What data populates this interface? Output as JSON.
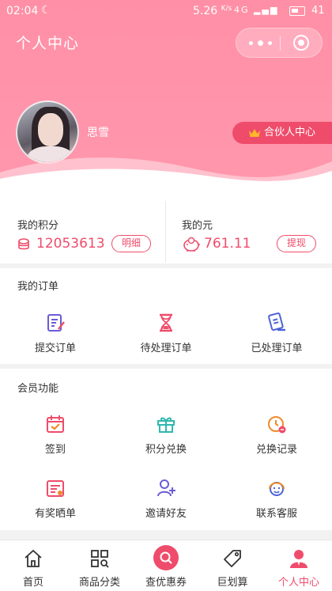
{
  "status_bar": {
    "time": "02:04",
    "speed": "5.26",
    "speed_unit": "K/s",
    "signal": "4G",
    "battery": "41"
  },
  "header": {
    "title": "个人中心",
    "user_name": "思雪",
    "partner_button": "合伙人中心"
  },
  "points": {
    "my_points_label": "我的积分",
    "my_points_value": "12053613",
    "detail_button": "明细",
    "my_yuan_label": "我的元",
    "my_yuan_value": "761.11",
    "withdraw_button": "提现"
  },
  "orders": {
    "title": "我的订单",
    "items": [
      {
        "label": "提交订单",
        "icon": "submit-order-icon"
      },
      {
        "label": "待处理订单",
        "icon": "hourglass-icon"
      },
      {
        "label": "已处理订单",
        "icon": "processed-order-icon"
      }
    ]
  },
  "members": {
    "title": "会员功能",
    "items": [
      {
        "label": "签到",
        "icon": "calendar-checkin-icon"
      },
      {
        "label": "积分兑换",
        "icon": "gift-icon"
      },
      {
        "label": "兑换记录",
        "icon": "clock-record-icon"
      },
      {
        "label": "有奖晒单",
        "icon": "share-order-icon"
      },
      {
        "label": "邀请好友",
        "icon": "invite-friend-icon"
      },
      {
        "label": "联系客服",
        "icon": "customer-service-icon"
      }
    ]
  },
  "tabbar": {
    "items": [
      {
        "label": "首页",
        "icon": "home-icon"
      },
      {
        "label": "商品分类",
        "icon": "category-icon"
      },
      {
        "label": "查优惠券",
        "icon": "coupon-search-icon"
      },
      {
        "label": "巨划算",
        "icon": "tag-icon"
      },
      {
        "label": "个人中心",
        "icon": "profile-icon"
      }
    ],
    "active_index": 4
  },
  "colors": {
    "accent": "#ef4c6b",
    "header_pink": "#ff97ad",
    "icon_purple": "#6a5bd6",
    "icon_teal": "#2fb8b0",
    "icon_orange": "#f08a2c"
  }
}
